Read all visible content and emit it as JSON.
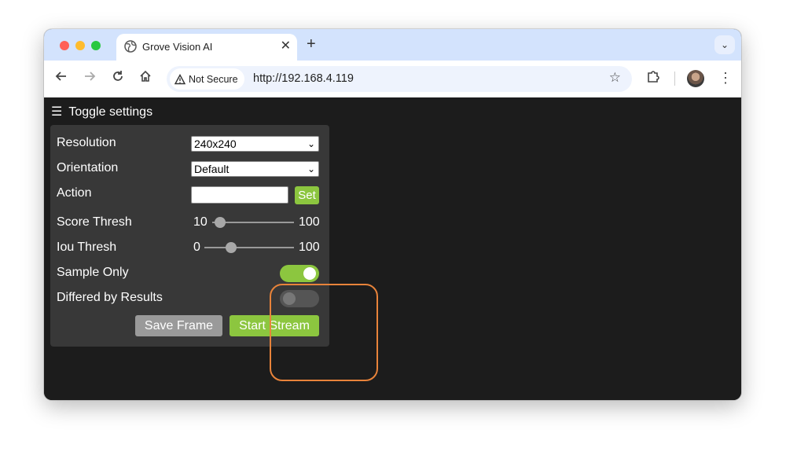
{
  "browser": {
    "tab_title": "Grove Vision AI",
    "tab_close": "✕",
    "new_tab": "+",
    "tab_menu": "⌄",
    "security_label": "Not Secure",
    "url": "http://192.168.4.119"
  },
  "app": {
    "toggle_label": "Toggle settings",
    "settings": {
      "resolution_label": "Resolution",
      "resolution_value": "240x240",
      "orientation_label": "Orientation",
      "orientation_value": "Default",
      "action_label": "Action",
      "action_value": "",
      "set_label": "Set",
      "score_label": "Score Thresh",
      "score_value": "10",
      "score_max": "100",
      "score_level": 0.1,
      "iou_label": "Iou Thresh",
      "iou_value": "0",
      "iou_max": "100",
      "iou_level": 0.3,
      "sample_label": "Sample Only",
      "sample_on": true,
      "differed_label": "Differed by Results",
      "differed_on": false,
      "save_label": "Save Frame",
      "start_label": "Start Stream"
    }
  },
  "colors": {
    "accent_green": "#8cc63f",
    "highlight_orange": "#e8833a",
    "panel_bg": "#383838",
    "page_bg": "#1c1c1c"
  },
  "icons": {
    "tab": "globe-icon",
    "back": "back-arrow-icon",
    "forward": "forward-arrow-icon",
    "reload": "reload-icon",
    "home": "home-icon",
    "warning": "warning-triangle-icon",
    "bookmark": "star-icon",
    "extensions": "puzzle-icon",
    "menu": "kebab-menu-icon",
    "toggle": "hamburger-icon"
  }
}
